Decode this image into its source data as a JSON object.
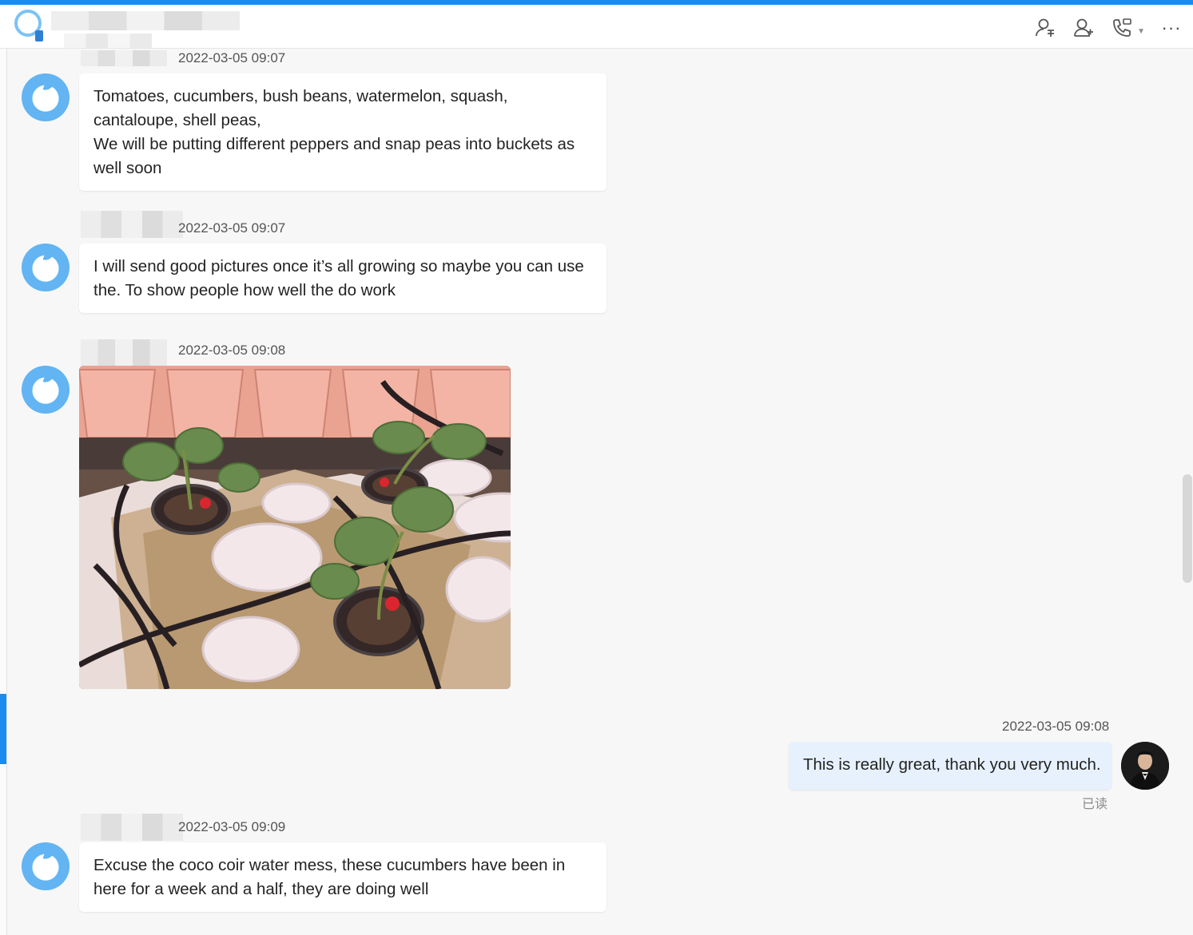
{
  "header": {
    "tools": [
      {
        "icon": "add-contact-icon"
      },
      {
        "icon": "add-member-icon"
      },
      {
        "icon": "call-icon"
      },
      {
        "icon": "more-icon",
        "label": "···"
      }
    ]
  },
  "messages": [
    {
      "direction": "incoming",
      "timestamp": "2022-03-05 09:07",
      "lines": [
        "Tomatoes, cucumbers, bush beans, watermelon, squash,",
        "cantaloupe, shell peas,",
        "We will be putting different peppers and snap peas into buckets as",
        "well soon"
      ]
    },
    {
      "direction": "incoming",
      "timestamp": "2022-03-05 09:07",
      "lines": [
        "I will send good pictures once it’s all growing so maybe you can use",
        "the. To show people how well the do work"
      ]
    },
    {
      "direction": "incoming",
      "timestamp": "2022-03-05 09:08",
      "type": "image"
    },
    {
      "direction": "outgoing",
      "timestamp": "2022-03-05 09:08",
      "lines": [
        "This is really great, thank you very much."
      ],
      "status": "已读"
    },
    {
      "direction": "incoming",
      "timestamp": "2022-03-05 09:09",
      "lines": [
        "Excuse the coco coir water mess, these cucumbers have been in",
        "here for a week and a half, they are doing well"
      ]
    }
  ]
}
